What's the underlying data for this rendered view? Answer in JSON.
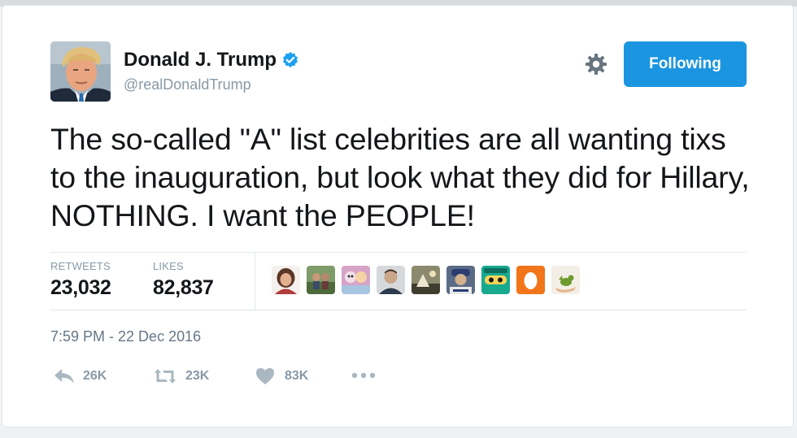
{
  "user": {
    "display_name": "Donald J. Trump",
    "handle": "@realDonaldTrump",
    "verified_icon": "verified-badge-icon"
  },
  "header": {
    "follow_label": "Following",
    "settings_icon": "gear-icon"
  },
  "tweet": {
    "text": "The so-called \"A\" list celebrities are all wanting tixs to the inauguration, but look what they did for Hillary, NOTHING. I want the PEOPLE!",
    "timestamp": "7:59 PM - 22 Dec 2016"
  },
  "stats": {
    "retweets_label": "RETWEETS",
    "retweets_value": "23,032",
    "likes_label": "LIKES",
    "likes_value": "82,837"
  },
  "actions": {
    "reply_count": "26K",
    "retweet_count": "23K",
    "like_count": "83K"
  },
  "colors": {
    "accent": "#1b95e0",
    "text": "#14171a",
    "muted": "#8899a6"
  }
}
